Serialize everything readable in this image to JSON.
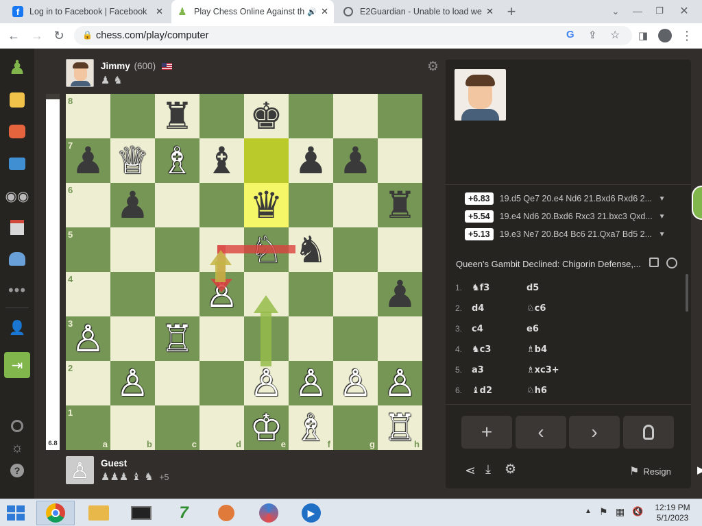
{
  "browser": {
    "tabs": [
      {
        "title": "Log in to Facebook | Facebook",
        "active": false
      },
      {
        "title": "Play Chess Online Against th",
        "active": true
      },
      {
        "title": "E2Guardian - Unable to load web",
        "active": false
      }
    ],
    "url": "chess.com/play/computer"
  },
  "sidebar": {
    "items": [
      "play-icon",
      "puzzles-icon",
      "learn-icon",
      "courses-icon",
      "watch-icon",
      "news-icon",
      "social-icon",
      "more-icon",
      "signup-icon",
      "login-icon"
    ],
    "bottom": [
      "language-icon",
      "theme-icon",
      "help-icon"
    ]
  },
  "opponent": {
    "name": "Jimmy",
    "rating": "(600)",
    "flag": "US",
    "captured": "♟ ♞"
  },
  "player": {
    "name": "Guest",
    "captured": "♟♟♟ ♝ ♞",
    "advantage": "+5"
  },
  "eval_bar": {
    "value": "6.8",
    "white_fraction": 0.985
  },
  "board": {
    "files": [
      "a",
      "b",
      "c",
      "d",
      "e",
      "f",
      "g",
      "h"
    ],
    "ranks": [
      "8",
      "7",
      "6",
      "5",
      "4",
      "3",
      "2",
      "1"
    ],
    "position": [
      [
        "",
        "",
        "♜",
        "",
        "♚",
        "",
        "",
        ""
      ],
      [
        "♟",
        "♕",
        "♗",
        "♝",
        "",
        "♟",
        "♟",
        ""
      ],
      [
        "",
        "♟",
        "",
        "",
        "♛",
        "",
        "",
        "♜"
      ],
      [
        "",
        "",
        "",
        "",
        "♘",
        "♞",
        "",
        ""
      ],
      [
        "",
        "",
        "",
        "♙",
        "",
        "",
        "",
        "♟"
      ],
      [
        "♙",
        "",
        "♖",
        "",
        "",
        "",
        "",
        ""
      ],
      [
        "",
        "♙",
        "",
        "",
        "♙",
        "♙",
        "♙",
        "♙"
      ],
      [
        "",
        "",
        "",
        "",
        "♔",
        "♗",
        "",
        "♖"
      ]
    ],
    "colors": [
      [
        "",
        "",
        "b",
        "",
        "b",
        "",
        "",
        ""
      ],
      [
        "b",
        "w",
        "w",
        "b",
        "",
        "b",
        "b",
        ""
      ],
      [
        "",
        "b",
        "",
        "",
        "b",
        "",
        "",
        "b"
      ],
      [
        "",
        "",
        "",
        "",
        "w",
        "b",
        "",
        ""
      ],
      [
        "",
        "",
        "",
        "w",
        "",
        "",
        "",
        "b"
      ],
      [
        "w",
        "",
        "w",
        "",
        "",
        "",
        "",
        ""
      ],
      [
        "",
        "w",
        "",
        "",
        "w",
        "w",
        "w",
        "w"
      ],
      [
        "",
        "",
        "",
        "",
        "w",
        "w",
        "",
        "w"
      ]
    ],
    "highlights": [
      "e7",
      "e6"
    ]
  },
  "engine_lines": [
    {
      "score": "+6.83",
      "line": "19.d5 Qe7 20.e4 Nd6 21.Bxd6 Rxd6 2..."
    },
    {
      "score": "+5.54",
      "line": "19.e4 Nd6 20.Bxd6 Rxc3 21.bxc3 Qxd..."
    },
    {
      "score": "+5.13",
      "line": "19.e3 Ne7 20.Bc4 Bc6 21.Qxa7 Bd5 2..."
    }
  ],
  "opening": "Queen's Gambit Declined: Chigorin Defense,...",
  "moves": [
    {
      "n": "1.",
      "w": "♞f3",
      "b": "d5"
    },
    {
      "n": "2.",
      "w": "d4",
      "b": "♘c6"
    },
    {
      "n": "3.",
      "w": "c4",
      "b": "e6"
    },
    {
      "n": "4.",
      "w": "♞c3",
      "b": "♗b4"
    },
    {
      "n": "5.",
      "w": "a3",
      "b": "♗xc3+"
    },
    {
      "n": "6.",
      "w": "♝d2",
      "b": "♘h6"
    }
  ],
  "controls": {
    "resign": "Resign"
  },
  "taskbar": {
    "time": "12:19 PM",
    "date": "5/1/2023"
  }
}
